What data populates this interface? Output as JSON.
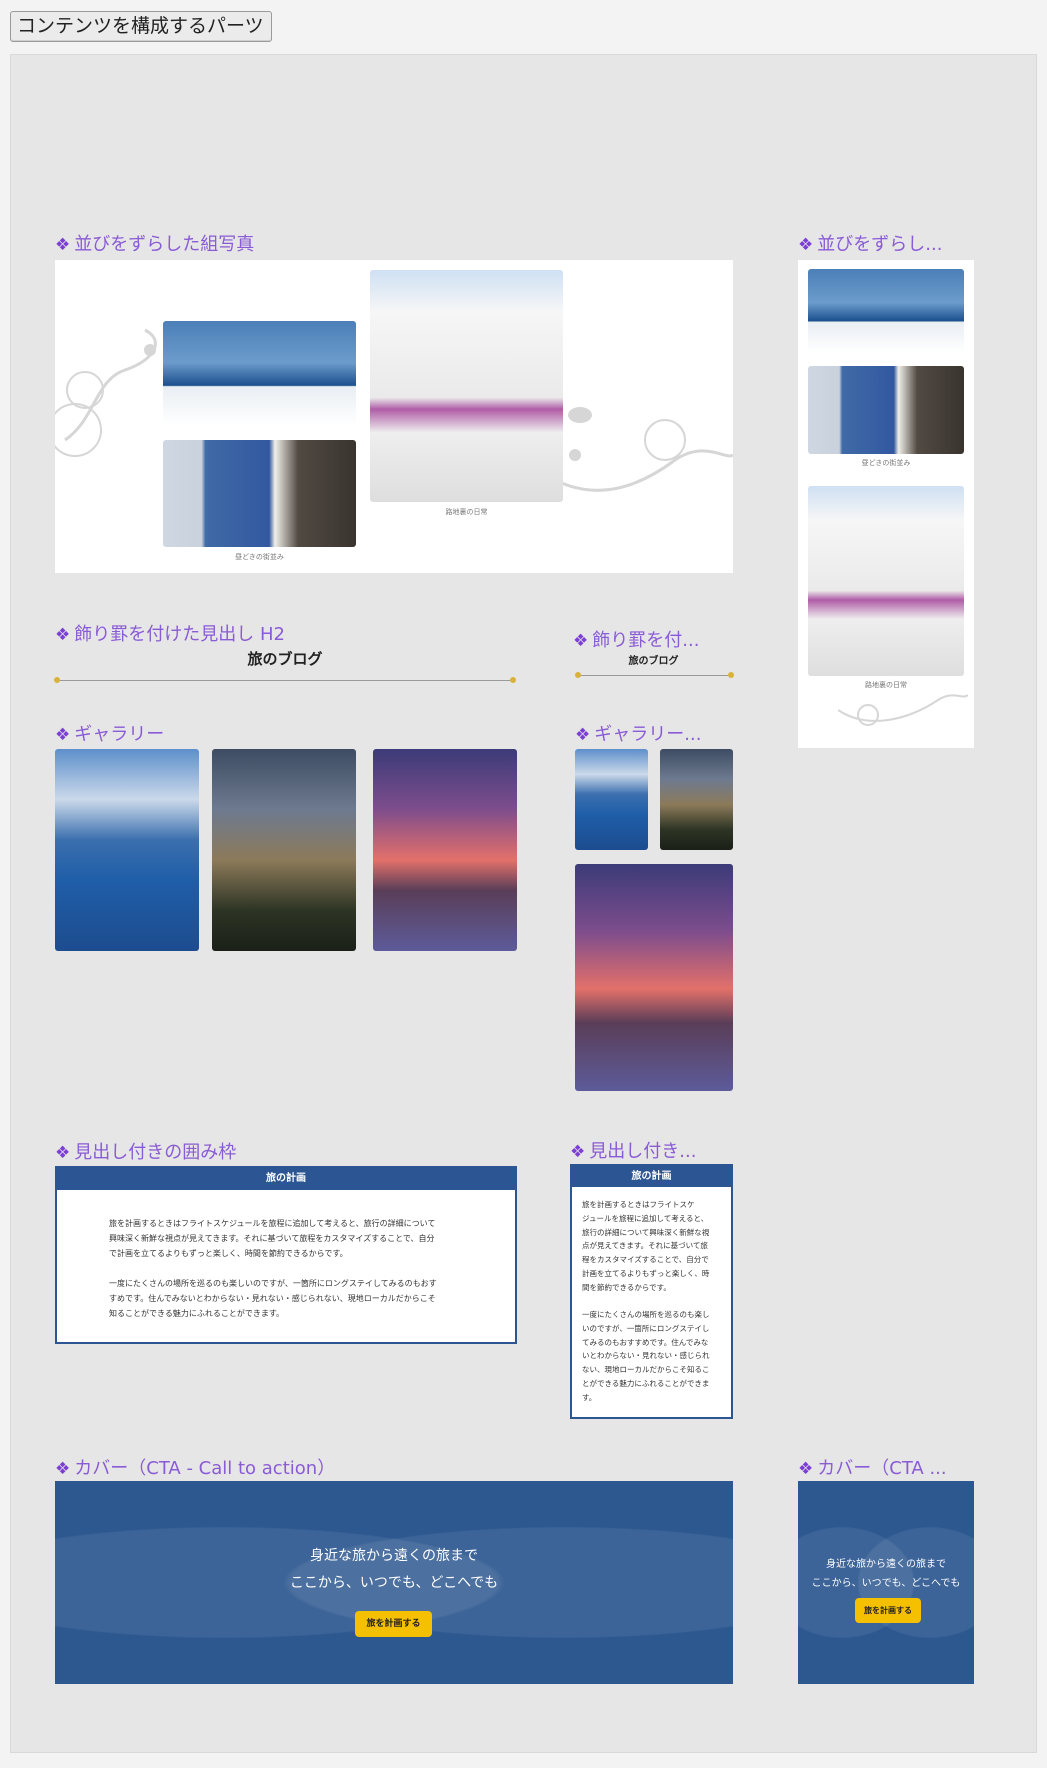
{
  "header": {
    "button_label": "コンテンツを構成するパーツ"
  },
  "sections": {
    "photo_group": {
      "title": "並びをずらした組写真",
      "title_short": "並びをずらし...",
      "caption_town": "昼どきの街並み",
      "caption_house": "路地裏の日常"
    },
    "heading": {
      "title": "飾り罫を付けた見出し H2",
      "title_short": "飾り罫を付...",
      "text": "旅のブログ"
    },
    "gallery": {
      "title": "ギャラリー",
      "title_short": "ギャラリー..."
    },
    "box": {
      "title": "見出し付きの囲み枠",
      "title_short": "見出し付き...",
      "head": "旅の計画",
      "para1": "旅を計画するときはフライトスケジュールを旅程に追加して考えると、旅行の詳細について\n興味深く新鮮な視点が見えてきます。それに基づいて旅程をカスタマイズすることで、自分\nで計画を立てるよりもずっと楽しく、時間を節約できるからです。",
      "para2": "一度にたくさんの場所を巡るのも楽しいのですが、一箇所にロングステイしてみるのもおす\nすめです。住んでみないとわからない・見れない・感じられない、現地ローカルだからこそ\n知ることができる魅力にふれることができます。",
      "para1_narrow": "旅を計画するときはフライトスケ\nジュールを旅程に追加して考えると、\n旅行の詳細について興味深く新鮮な視\n点が見えてきます。それに基づいて旅\n程をカスタマイズすることで、自分で\n計画を立てるよりもずっと楽しく、時\n間を節約できるからです。",
      "para2_narrow": "一度にたくさんの場所を巡るのも楽し\nいのですが、一箇所にロングステイし\nてみるのもおすすめです。住んでみな\nいとわからない・見れない・感じられ\nない、現地ローカルだからこそ知るこ\nとができる魅力にふれることができま\nす。"
    },
    "cta": {
      "title": "カバー（CTA - Call to action）",
      "title_short": "カバー（CTA ...",
      "line1": "身近な旅から遠くの旅まで",
      "line2": "ここから、いつでも、どこへでも",
      "button": "旅を計画する"
    }
  },
  "colors": {
    "title": "#8a5bd6",
    "box_border": "#2c5693",
    "cta_bg": "#2c578f",
    "cta_button": "#f5c000",
    "rule_dot": "#d9b23a"
  }
}
